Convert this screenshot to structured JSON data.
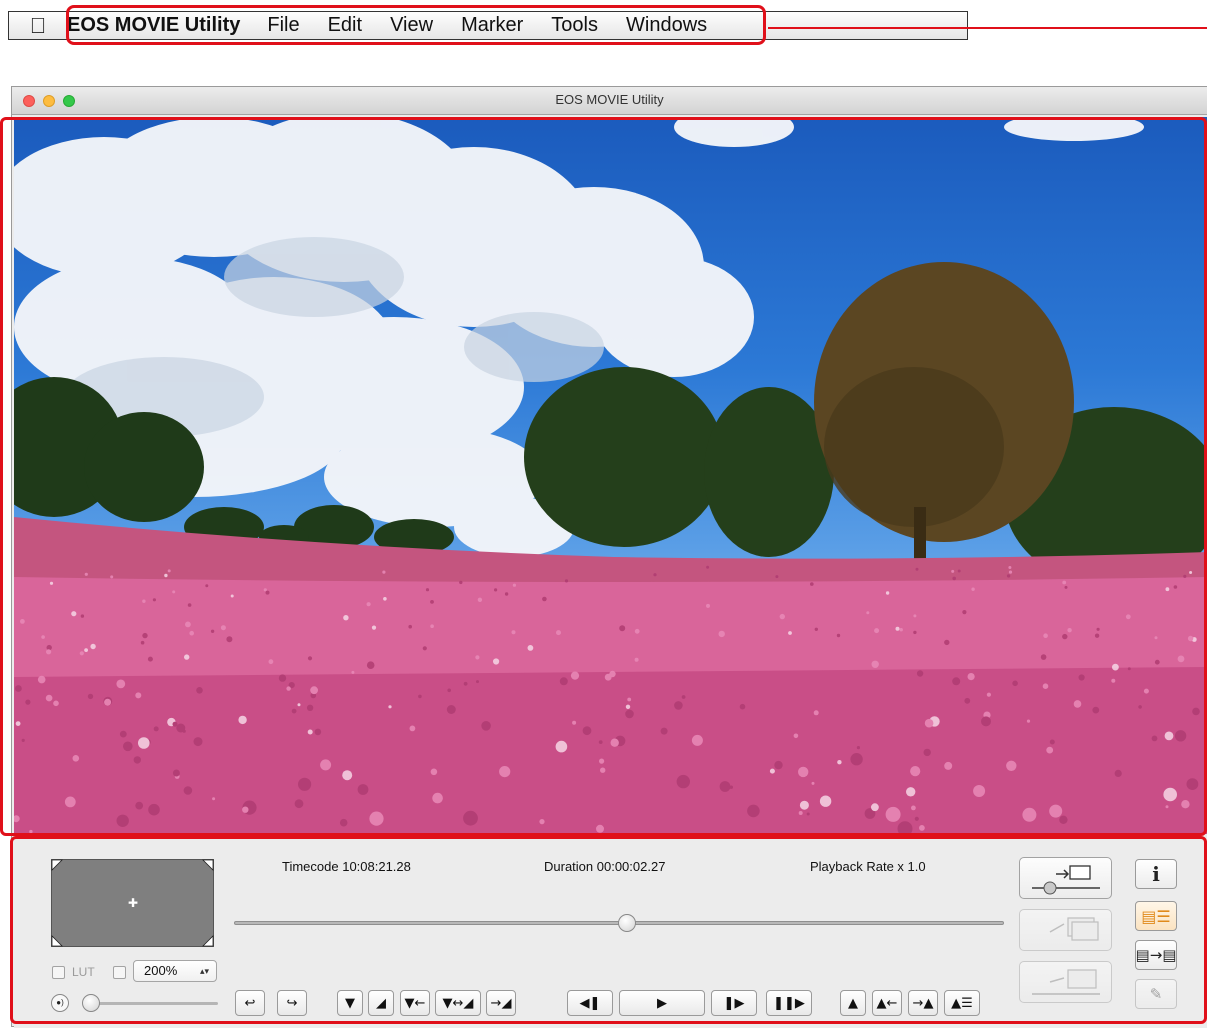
{
  "menubar": {
    "apple_icon": "apple-logo-icon",
    "app_name": "EOS MOVIE Utility",
    "items": [
      "File",
      "Edit",
      "View",
      "Marker",
      "Tools",
      "Windows"
    ]
  },
  "window": {
    "title": "EOS MOVIE Utility"
  },
  "controls": {
    "timecode": "Timecode 10:08:21.28",
    "duration": "Duration 00:00:02.27",
    "playback_rate": "Playback Rate x 1.0",
    "lut_label": "LUT",
    "zoom_value": "200%",
    "zoom_arrow": "▴▾",
    "volume_icon": "speaker-icon",
    "position_fraction": 0.5
  },
  "colors": {
    "highlight": "#e0101a",
    "sky": "#2c79d6",
    "flowers": "#d9659a"
  }
}
